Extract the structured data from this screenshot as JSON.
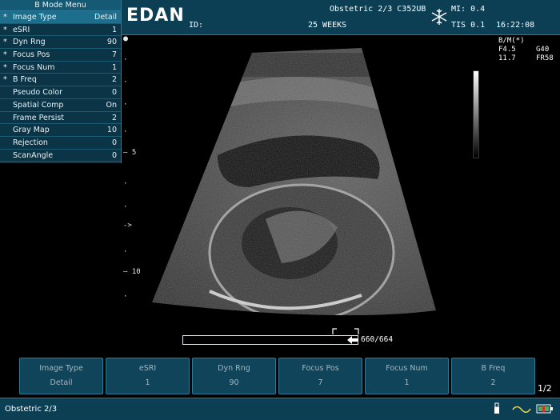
{
  "header": {
    "brand": "EDAN",
    "id_label": "ID:",
    "preset": "Obstetric 2/3 C352UB",
    "gestation": "25 WEEKS",
    "mi": "MI: 0.4",
    "tis": "TIS 0.1",
    "time": "16:22:08",
    "freeze_icon": "snowflake-icon"
  },
  "menu": {
    "title": "B Mode Menu",
    "items": [
      {
        "star": "*",
        "label": "Image Type",
        "value": "Detail"
      },
      {
        "star": "*",
        "label": "eSRI",
        "value": "1"
      },
      {
        "star": "*",
        "label": "Dyn Rng",
        "value": "90"
      },
      {
        "star": "*",
        "label": "Focus Pos",
        "value": "7"
      },
      {
        "star": "*",
        "label": "Focus Num",
        "value": "1"
      },
      {
        "star": "*",
        "label": "B Freq",
        "value": "2"
      },
      {
        "star": "",
        "label": "Pseudo Color",
        "value": "0"
      },
      {
        "star": "",
        "label": "Spatial Comp",
        "value": "On"
      },
      {
        "star": "",
        "label": "Frame Persist",
        "value": "2"
      },
      {
        "star": "",
        "label": "Gray Map",
        "value": "10"
      },
      {
        "star": "",
        "label": "Rejection",
        "value": "0"
      },
      {
        "star": "",
        "label": "ScanAngle",
        "value": "0"
      }
    ]
  },
  "image_info": {
    "mode": "B/M(*)",
    "freq": "F4.5",
    "gain": "G40",
    "depth": "11.7",
    "frame_rate": "FR58"
  },
  "depth_scale": {
    "mark_5": "5",
    "mark_10": "10",
    "focus_marker": "->"
  },
  "cine": {
    "counter": "660/664"
  },
  "softkeys": [
    {
      "label": "Image Type",
      "value": "Detail"
    },
    {
      "label": "eSRI",
      "value": "1"
    },
    {
      "label": "Dyn Rng",
      "value": "90"
    },
    {
      "label": "Focus Pos",
      "value": "7"
    },
    {
      "label": "Focus Num",
      "value": "1"
    },
    {
      "label": "B Freq",
      "value": "2"
    }
  ],
  "page_indicator": "1/2",
  "status": {
    "mode": "Obstetric 2/3",
    "icons": [
      "usb-icon",
      "ecg-wave-icon",
      "battery-icon"
    ]
  },
  "colors": {
    "panel": "#0c3f54",
    "border": "#2d7a93",
    "highlight": "#1d6d8c"
  }
}
